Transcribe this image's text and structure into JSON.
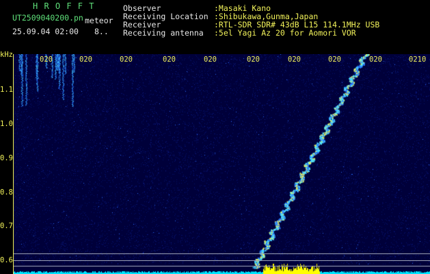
{
  "header": {
    "app_title": "H R O F F T",
    "filename": "UT2509040200.pn",
    "mode": "meteor",
    "datetime": "25.09.04 02:00",
    "count": "8..",
    "fields": [
      {
        "label": "Observer",
        "value": ":Masaki Kano"
      },
      {
        "label": "Receiving Location",
        "value": ":Shibukawa,Gunma,Japan"
      },
      {
        "label": "Receiver",
        "value": ":RTL-SDR SDR# 43dB L15 114.1MHz USB"
      },
      {
        "label": "Receiving antenna",
        "value": ":5el Yagi Az 20 for Aomori VOR"
      }
    ]
  },
  "axis": {
    "unit": "kHz",
    "y_ticks": [
      "1.1",
      "1.0",
      "0.9",
      "0.8",
      "0.7",
      "0.6"
    ],
    "x_ticks": [
      "020",
      "020",
      "020",
      "020",
      "020",
      "020",
      "020",
      "020",
      "020",
      "0210"
    ]
  },
  "colors": {
    "title": "#5fe07a",
    "text": "#e8e8e8",
    "axis": "#f2f25a",
    "background": "#000000",
    "signal": "#3cb4ff",
    "baseline": "#00e5ff",
    "burst": "#ffff00"
  }
}
